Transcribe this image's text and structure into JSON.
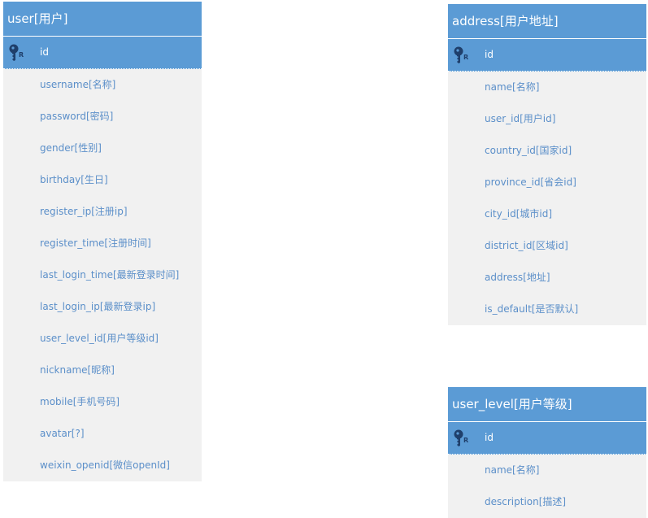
{
  "colors": {
    "header": "#5b9bd5",
    "body": "#f1f1f1",
    "field_text": "#5b8fc9",
    "pk_text": "#ffffff"
  },
  "icons": {
    "primary_key": "key-icon"
  },
  "tables": [
    {
      "title": "user[用户]",
      "fields": [
        "id",
        "username[名称]",
        "password[密码]",
        "gender[性别]",
        "birthday[生日]",
        "register_ip[注册ip]",
        "register_time[注册时间]",
        "last_login_time[最新登录时间]",
        "last_login_ip[最新登录ip]",
        "user_level_id[用户等级id]",
        "nickname[昵称]",
        "mobile[手机号码]",
        "avatar[?]",
        "weixin_openid[微信openId]"
      ]
    },
    {
      "title": "address[用户地址]",
      "fields": [
        "id",
        "name[名称]",
        "user_id[用户id]",
        "country_id[国家id]",
        "province_id[省会id]",
        "city_id[城市id]",
        "district_id[区域id]",
        "address[地址]",
        "is_default[是否默认]"
      ]
    },
    {
      "title": "user_level[用户等级]",
      "fields": [
        "id",
        "name[名称]",
        "description[描述]"
      ]
    }
  ]
}
